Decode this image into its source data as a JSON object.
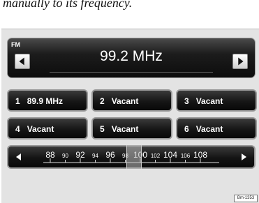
{
  "caption": "manually to its frequency.",
  "display": {
    "band": "FM",
    "frequency": "99.2 MHz",
    "prev_icon": "triangle-left-icon",
    "next_icon": "triangle-right-icon"
  },
  "presets": [
    {
      "number": "1",
      "label": "89.9 MHz"
    },
    {
      "number": "2",
      "label": "Vacant"
    },
    {
      "number": "3",
      "label": "Vacant"
    },
    {
      "number": "4",
      "label": "Vacant"
    },
    {
      "number": "5",
      "label": "Vacant"
    },
    {
      "number": "6",
      "label": "Vacant"
    }
  ],
  "scale": {
    "ticks": [
      "88",
      "90",
      "92",
      "94",
      "96",
      "98",
      "100",
      "102",
      "104",
      "106",
      "108"
    ],
    "current_mhz": 99.2
  },
  "figure_id": "Bm-1353",
  "colors": {
    "panel": "#0c0c0c",
    "screen_bg": "#e3e3e3",
    "text": "#ffffff"
  }
}
